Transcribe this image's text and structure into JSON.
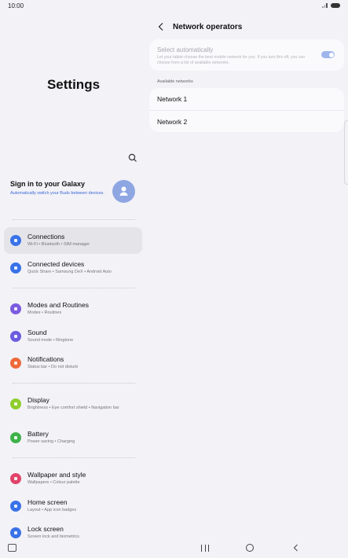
{
  "status": {
    "time": "10:00"
  },
  "left": {
    "title": "Settings",
    "signin": {
      "title": "Sign in to your Galaxy",
      "subtitle": "Automatically switch your Buds between devices."
    },
    "items": [
      {
        "title": "Connections",
        "sub": "Wi-Fi  •  Bluetooth  •  SIM manager",
        "icon": "wifi-icon",
        "color": "#3a72e8",
        "selected": true
      },
      {
        "title": "Connected devices",
        "sub": "Quick Share  •  Samsung DeX  •  Android Auto",
        "icon": "devices-icon",
        "color": "#3a72e8"
      },
      {
        "title": "Modes and Routines",
        "sub": "Modes  •  Routines",
        "icon": "check-circle-icon",
        "color": "#7b5be0"
      },
      {
        "title": "Sound",
        "sub": "Sound mode  •  Ringtone",
        "icon": "speaker-icon",
        "color": "#6b5ce0"
      },
      {
        "title": "Notifications",
        "sub": "Status bar  •  Do not disturb",
        "icon": "bell-icon",
        "color": "#ef6a3b"
      },
      {
        "title": "Display",
        "sub": "Brightness  •  Eye comfort shield  •  Navigation bar",
        "icon": "sun-icon",
        "color": "#8fce2e"
      },
      {
        "title": "Battery",
        "sub": "Power saving  •  Charging",
        "icon": "battery-icon",
        "color": "#3fb24a"
      },
      {
        "title": "Wallpaper and style",
        "sub": "Wallpapers  •  Colour palette",
        "icon": "palette-icon",
        "color": "#e0446a"
      },
      {
        "title": "Home screen",
        "sub": "Layout  •  App icon badges",
        "icon": "home-icon",
        "color": "#3a72e8"
      },
      {
        "title": "Lock screen",
        "sub": "Screen lock and biometrics",
        "icon": "lock-icon",
        "color": "#3a72e8"
      }
    ]
  },
  "right": {
    "title": "Network operators",
    "select_auto": {
      "title": "Select automatically",
      "desc": "Let your tablet choose the best mobile network for you. If you turn this off, you can choose from a list of available networks.",
      "enabled": true
    },
    "available_label": "Available networks",
    "networks": [
      "Network 1",
      "Network 2"
    ]
  }
}
